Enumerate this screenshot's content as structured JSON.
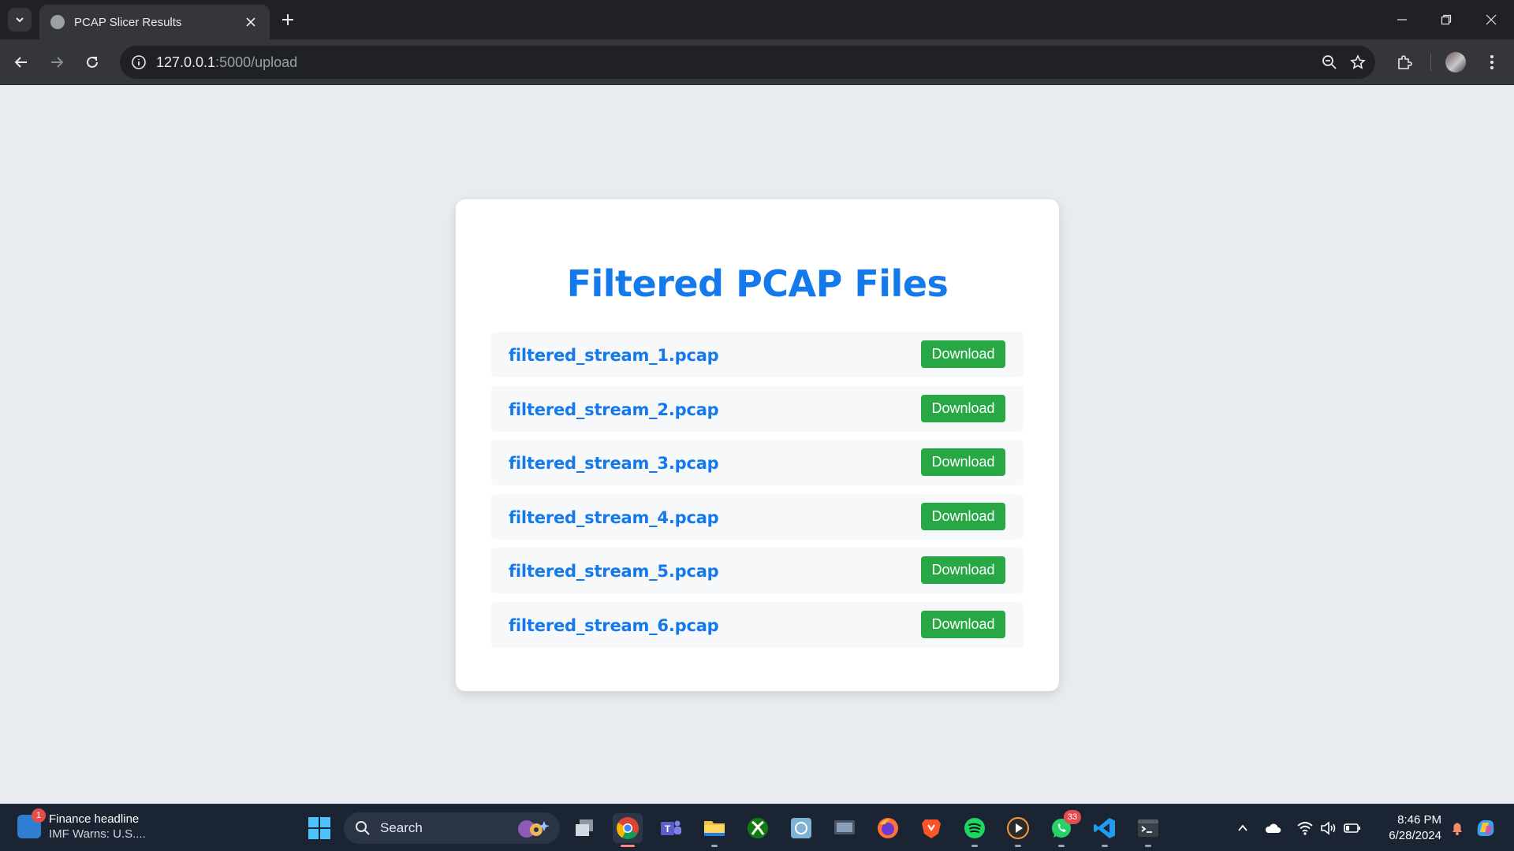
{
  "browser": {
    "tab_title": "PCAP Slicer Results",
    "url_host": "127.0.0.1",
    "url_rest": ":5000/upload"
  },
  "page": {
    "title": "Filtered PCAP Files",
    "accent_color": "#1479ea",
    "button_color": "#28a745",
    "files": [
      {
        "name": "filtered_stream_1.pcap",
        "action": "Download"
      },
      {
        "name": "filtered_stream_2.pcap",
        "action": "Download"
      },
      {
        "name": "filtered_stream_3.pcap",
        "action": "Download"
      },
      {
        "name": "filtered_stream_4.pcap",
        "action": "Download"
      },
      {
        "name": "filtered_stream_5.pcap",
        "action": "Download"
      },
      {
        "name": "filtered_stream_6.pcap",
        "action": "Download"
      }
    ]
  },
  "taskbar": {
    "widget_title": "Finance headline",
    "widget_subtitle": "IMF Warns: U.S....",
    "widget_badge": "1",
    "search_label": "Search",
    "whatsapp_badge": "33",
    "clock_time": "8:46 PM",
    "clock_date": "6/28/2024",
    "apps": [
      "windows-start",
      "task-view",
      "chrome",
      "teams",
      "file-explorer",
      "xbox",
      "app",
      "screen",
      "firefox",
      "brave",
      "spotify",
      "media-player",
      "whatsapp",
      "vscode",
      "terminal"
    ]
  }
}
